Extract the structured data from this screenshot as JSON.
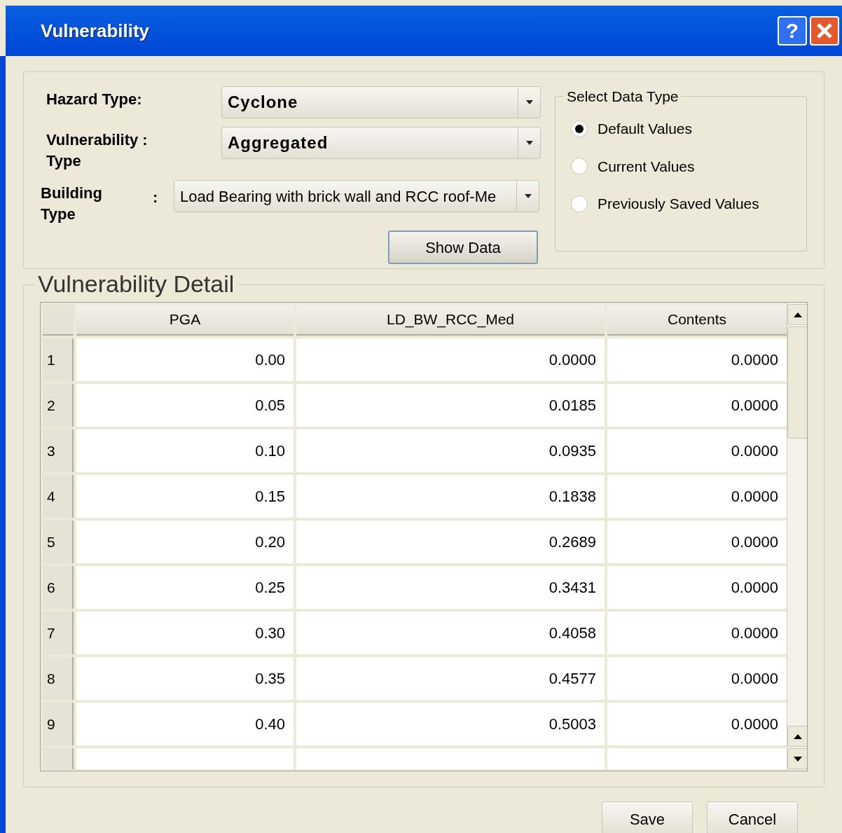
{
  "window": {
    "title": "Vulnerability"
  },
  "title_buttons": [
    {
      "kind": "help",
      "label": "?"
    },
    {
      "kind": "close"
    }
  ],
  "fields": [
    {
      "label": "Hazard Type:",
      "value": "Cyclone",
      "bold": true
    },
    {
      "label": "Vulnerability :\nType",
      "value": "Aggregated",
      "bold": true
    },
    {
      "label": "Building\nType",
      "separator": ":",
      "value": "Load Bearing with brick wall and RCC roof-Me",
      "bold": false
    }
  ],
  "show_data_button": "Show Data",
  "data_type": {
    "title": "Select Data Type",
    "options": [
      {
        "label": "Default Values",
        "selected": true
      },
      {
        "label": "Current Values",
        "selected": false
      },
      {
        "label": "Previously Saved Values",
        "selected": false
      }
    ]
  },
  "detail": {
    "title": "Vulnerability Detail",
    "columns": [
      "PGA",
      "LD_BW_RCC_Med",
      "Contents"
    ],
    "rows": [
      {
        "index": "1",
        "cells": [
          "0.00",
          "0.0000",
          "0.0000"
        ]
      },
      {
        "index": "2",
        "cells": [
          "0.05",
          "0.0185",
          "0.0000"
        ]
      },
      {
        "index": "3",
        "cells": [
          "0.10",
          "0.0935",
          "0.0000"
        ]
      },
      {
        "index": "4",
        "cells": [
          "0.15",
          "0.1838",
          "0.0000"
        ]
      },
      {
        "index": "5",
        "cells": [
          "0.20",
          "0.2689",
          "0.0000"
        ]
      },
      {
        "index": "6",
        "cells": [
          "0.25",
          "0.3431",
          "0.0000"
        ]
      },
      {
        "index": "7",
        "cells": [
          "0.30",
          "0.4058",
          "0.0000"
        ]
      },
      {
        "index": "8",
        "cells": [
          "0.35",
          "0.4577",
          "0.0000"
        ]
      },
      {
        "index": "9",
        "cells": [
          "0.40",
          "0.5003",
          "0.0000"
        ]
      }
    ]
  },
  "buttons": [
    "Save",
    "Cancel"
  ]
}
